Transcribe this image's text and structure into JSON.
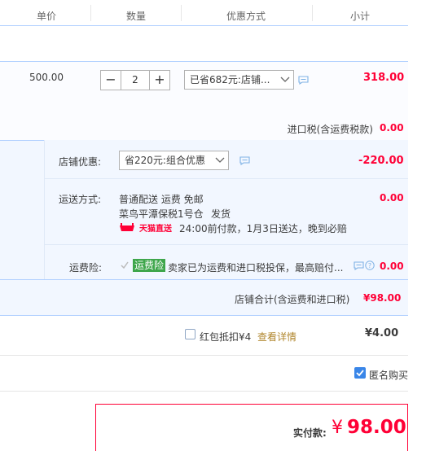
{
  "header": {
    "col_unit_price": "单价",
    "col_quantity": "数量",
    "col_discount": "优惠方式",
    "col_subtotal": "小计"
  },
  "item": {
    "unit_price": "500.00",
    "quantity": "2",
    "discount_select": "已省682元:店铺...",
    "subtotal": "318.00",
    "quantity_minus": "−",
    "quantity_plus": "+"
  },
  "tax": {
    "label": "进口税(含运费税款)",
    "value": "0.00"
  },
  "shop": {
    "discount_label": "店铺优惠:",
    "discount_select": "省220元:组合优惠",
    "discount_value": "-220.00",
    "shipping_label": "运送方式:",
    "shipping_method": "普通配送 运费 免邮",
    "warehouse": "菜鸟平潭保税1号仓",
    "ship_from": "发货",
    "tmall_badge": "天猫直送",
    "delivery_note": "24:00前付款，1月3日送达，晚到必赔",
    "shipping_value": "0.00",
    "insurance_label": "运费险:",
    "insurance_tag": "运费险",
    "insurance_text": "卖家已为运费和进口税投保，最高赔付...",
    "insurance_value": "0.00",
    "total_label": "店铺合计(含运费和进口税)",
    "total_value": "¥98.00"
  },
  "redpacket": {
    "label": "红包抵扣¥4",
    "details_link": "查看详情",
    "value": "¥4.00"
  },
  "anonymous": {
    "label": "匿名购买",
    "checked": true
  },
  "payment": {
    "label": "实付款:",
    "currency": "¥",
    "amount": "98.00"
  },
  "colors": {
    "accent_red": "#ff0036",
    "border_blue": "#b2d1ff",
    "checkbox_blue": "#3a86e8",
    "insurance_green": "#3ea64b",
    "link_brown": "#b0862c"
  }
}
